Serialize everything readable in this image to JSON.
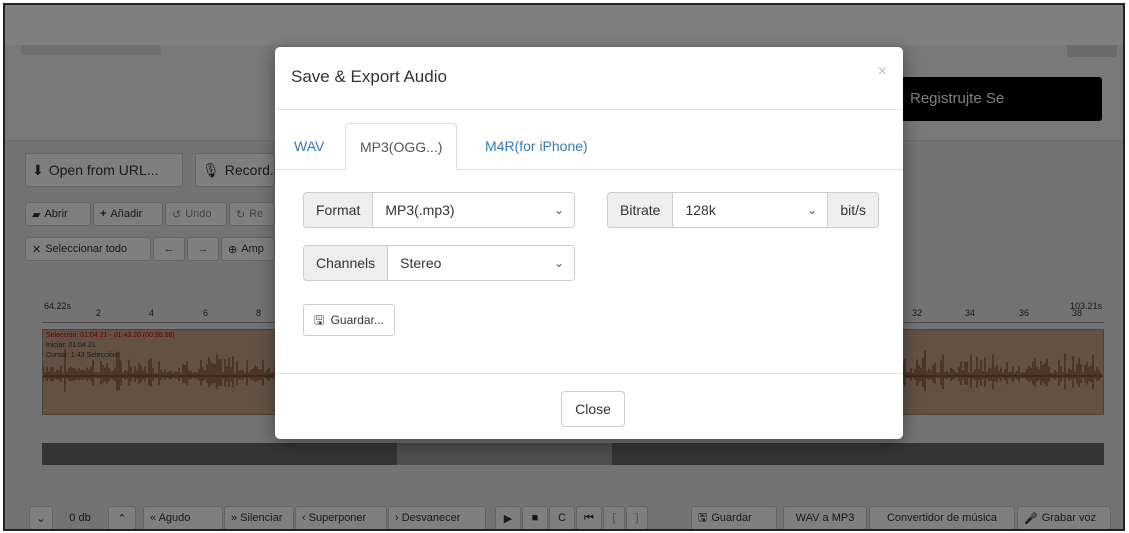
{
  "header": {
    "register_label": "Registrujte Se"
  },
  "toolbar_row1": [
    {
      "icon": "download-icon",
      "label": "Open from URL..."
    },
    {
      "icon": "microphone-icon",
      "label": "Record..."
    }
  ],
  "toolbar_row2": [
    {
      "icon": "folder-icon",
      "label": "Abrir"
    },
    {
      "icon": "plus-icon",
      "label": "Añadir"
    },
    {
      "icon": "undo-icon",
      "label": "Undo"
    },
    {
      "icon": "redo-icon",
      "label": "Re"
    }
  ],
  "toolbar_row3": [
    {
      "icon": "select-all-icon",
      "label": "Seleccionar todo"
    },
    {
      "icon": "arrow-left-icon",
      "label": "←"
    },
    {
      "icon": "arrow-right-icon",
      "label": "→"
    },
    {
      "icon": "zoom-icon",
      "label": "Amp"
    }
  ],
  "timeline": {
    "start_label": "64.22s",
    "end_label": "103.21s",
    "left_ticks": [
      "2",
      "4",
      "6",
      "8"
    ],
    "right_ticks": [
      "32",
      "34",
      "36",
      "38"
    ],
    "selection_text": "Selección: 01:04.21 - 01:43.20 (00:38.98)",
    "start_text": "Iniciar: 01:04.21",
    "cursor_text": "Cursor: 1:43 Selección"
  },
  "bottombar": {
    "db_label": "0 db",
    "items": [
      "« Agudo",
      "» Silenciar",
      "‹ Superponer",
      "› Desvanecer"
    ],
    "guardar": "Guardar",
    "wav_mp3": "WAV a MP3",
    "convertidor": "Convertidor de música",
    "grabar": "Grabar voz"
  },
  "modal": {
    "title": "Save & Export Audio",
    "close_x": "×",
    "tabs": [
      "WAV",
      "MP3(OGG...)",
      "M4R(for iPhone)"
    ],
    "active_tab": 1,
    "format_label": "Format",
    "format_value": "MP3(.mp3)",
    "bitrate_label": "Bitrate",
    "bitrate_value": "128k",
    "bitrate_unit": "bit/s",
    "channels_label": "Channels",
    "channels_value": "Stereo",
    "save_label": "Guardar...",
    "close_label": "Close"
  },
  "colors": {
    "accent": "#337ab7",
    "overlay": "#000000",
    "wave": "#7a3e22",
    "wave_bg": "#c7a489"
  }
}
